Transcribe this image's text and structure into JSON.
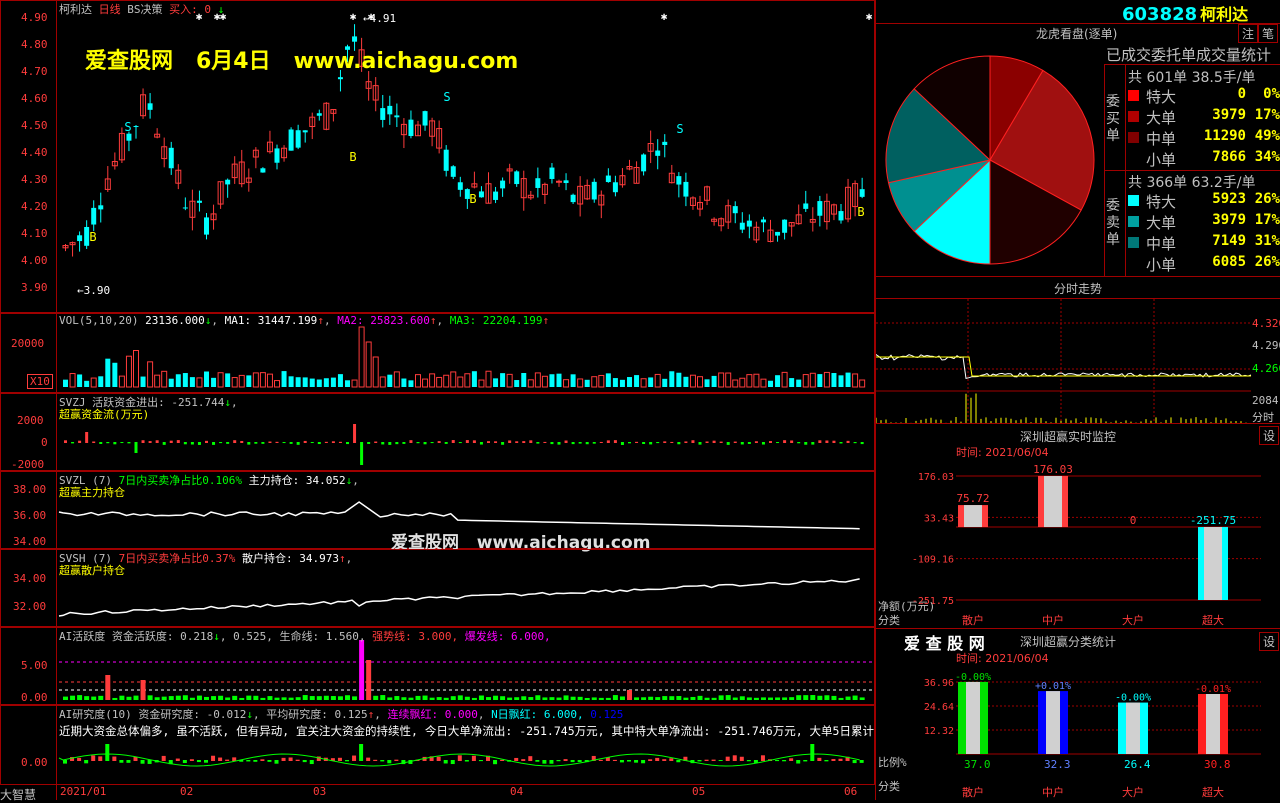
{
  "main": {
    "title_name": "柯利达",
    "period": "日线",
    "indicator": "BS决策",
    "buy_label": "买入: 0",
    "high_mark": "4.91",
    "low_mark": "3.90",
    "y_ticks": [
      "4.90",
      "4.80",
      "4.70",
      "4.60",
      "4.50",
      "4.40",
      "4.30",
      "4.20",
      "4.10",
      "4.00",
      "3.90"
    ],
    "watermark_site": "爱查股网",
    "watermark_date": "6月4日",
    "watermark_url": "www.aichagu.com",
    "signal_s": "S",
    "signal_b": "B"
  },
  "vol": {
    "label": "VOL(5,10,20)",
    "value": "23136.000",
    "ma1": "MA1: 31447.199",
    "ma2": "MA2: 25823.600",
    "ma3": "MA3: 22204.199",
    "y_tick": "20000",
    "unit": "X10"
  },
  "svzj": {
    "label": "SVZJ  活跃资金进出: -251.744",
    "sub": "超赢资金流(万元)",
    "y_ticks": [
      "2000",
      "0",
      "-2000"
    ]
  },
  "svzl": {
    "label": "SVZL (7)",
    "part2": "7日内买卖净占比0.106%",
    "part3": "主力持仓: 34.052",
    "sub": "超赢主力持仓",
    "y_ticks": [
      "38.00",
      "36.00",
      "34.00"
    ]
  },
  "svsh": {
    "label": "SVSH (7)",
    "part2": "7日内买卖净占比0.37%",
    "part3": "散户持仓: 34.973",
    "sub": "超赢散户持仓",
    "y_ticks": [
      "34.00",
      "32.00"
    ]
  },
  "ai": {
    "label": "AI活跃度 资金活跃度: 0.218",
    "part2": "0.525,",
    "part3": "生命线: 1.560,",
    "part4": "强势线: 3.000,",
    "part5": "爆发线: 6.000,",
    "y_ticks": [
      "5.00",
      "0.00"
    ]
  },
  "research": {
    "label": "AI研究度(10) 资金研究度: -0.012",
    "part2": "平均研究度: 0.125",
    "part3": "连续飘红: 0.000",
    "part4": "N日飘红: 6.000,",
    "part5": "0.125",
    "comment": "近期大资金总体偏多, 虽不活跃, 但有异动, 宜关注大资金的持续性, 今日大单净流出: -251.745万元, 其中特大单净流出: -251.746万元, 大单5日累计净",
    "y_tick": "0.00"
  },
  "xaxis": [
    "2021/01",
    "02",
    "03",
    "04",
    "05",
    "06"
  ],
  "bottom_left": "大智慧",
  "right": {
    "code": "603828",
    "name": "柯利达",
    "btn_zhu": "注",
    "btn_bi": "笔",
    "pie_title": "龙虎看盘(逐单)",
    "stats_title": "已成交委托单成交量统计",
    "buy_side": "委买单",
    "sell_side": "委卖单",
    "buy_total": "共 601单 38.5手/单",
    "sell_total": "共 366单 63.2手/单",
    "buy_rows": [
      {
        "name": "特大",
        "count": "0",
        "pct": "0%",
        "color": "#ff0000"
      },
      {
        "name": "大单",
        "count": "3979",
        "pct": "17%",
        "color": "#b00000"
      },
      {
        "name": "中单",
        "count": "11290",
        "pct": "49%",
        "color": "#800000"
      },
      {
        "name": "小单",
        "count": "7866",
        "pct": "34%",
        "color": ""
      }
    ],
    "sell_rows": [
      {
        "name": "特大",
        "count": "5923",
        "pct": "26%",
        "color": "#00ffff"
      },
      {
        "name": "大单",
        "count": "3979",
        "pct": "17%",
        "color": "#00a0a0"
      },
      {
        "name": "中单",
        "count": "7149",
        "pct": "31%",
        "color": "#007878"
      },
      {
        "name": "小单",
        "count": "6085",
        "pct": "26%",
        "color": ""
      }
    ],
    "minute_title": "分时走势",
    "minute_prices": [
      "4.320",
      "4.290",
      "4.260"
    ],
    "minute_vol": "2084",
    "minute_unit": "分时",
    "monitor_title": "深圳超赢实时监控",
    "monitor_btn": "设",
    "monitor_time": "时间: 2021/06/04",
    "monitor_yticks": [
      "176.03",
      "33.43",
      "-109.16",
      "-251.75"
    ],
    "monitor_ylabel": "净额(万元)",
    "monitor_xlabel": "分类",
    "class_title_site": "爱 查 股 网",
    "class_title": "深圳超赢分类统计",
    "class_btn": "设",
    "class_time": "时间: 2021/06/04",
    "class_yticks": [
      "36.96",
      "24.64",
      "12.32"
    ],
    "class_ylabel": "比例%",
    "class_xlabel": "分类"
  },
  "chart_data": [
    {
      "type": "bar",
      "title": "深圳超赢实时监控",
      "categories": [
        "散户",
        "中户",
        "大户",
        "超大"
      ],
      "values": [
        75.72,
        176.03,
        0,
        -251.75
      ],
      "value_labels": [
        "75.72",
        "176.03",
        "0",
        "-251.75"
      ],
      "ylim": [
        -251.75,
        176.03
      ],
      "ylabel": "净额(万元)",
      "xlabel": "分类"
    },
    {
      "type": "bar",
      "title": "深圳超赢分类统计",
      "categories": [
        "散户",
        "中户",
        "大户",
        "超大"
      ],
      "values": [
        37.0,
        32.3,
        26.4,
        30.8
      ],
      "value_labels": [
        "37.0",
        "32.3",
        "26.4",
        "30.8"
      ],
      "change_labels": [
        "-0.00%",
        "+0.01%",
        "-0.00%",
        "-0.01%"
      ],
      "colors": [
        "#00e000",
        "#0000ff",
        "#00ffff",
        "#ff2020"
      ],
      "ylim": [
        0,
        36.96
      ],
      "ylabel": "比例%",
      "xlabel": "分类"
    },
    {
      "type": "pie",
      "title": "龙虎看盘(逐单)",
      "slices": [
        {
          "name": "买-大单",
          "value": 17,
          "color": "#8b0000"
        },
        {
          "name": "买-中单",
          "value": 49,
          "color": "#a01010"
        },
        {
          "name": "买-小单",
          "value": 34,
          "color": "#200000"
        },
        {
          "name": "卖-特大",
          "value": 26,
          "color": "#00ffff"
        },
        {
          "name": "卖-大单",
          "value": 17,
          "color": "#009090"
        },
        {
          "name": "卖-中单",
          "value": 31,
          "color": "#006060"
        },
        {
          "name": "卖-小单",
          "value": 26,
          "color": "#100000"
        }
      ]
    }
  ]
}
